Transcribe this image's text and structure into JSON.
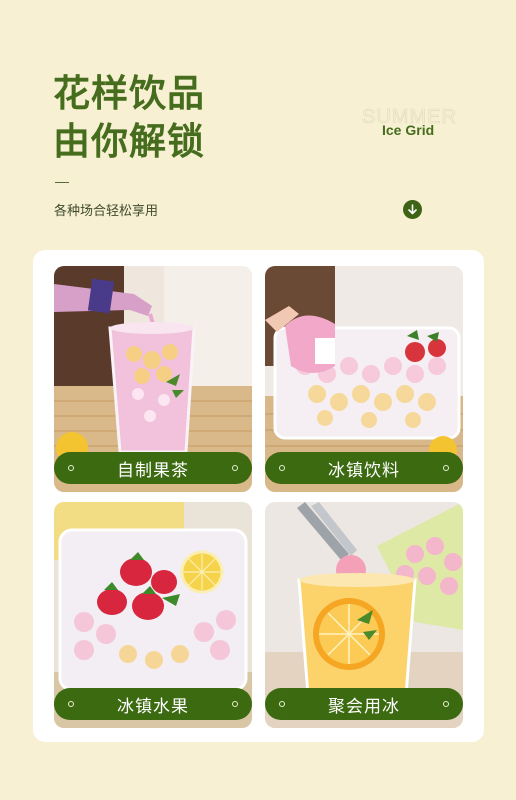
{
  "header": {
    "title_line1": "花样饮品",
    "title_line2": "由你解锁",
    "subtitle": "各种场合轻松享用",
    "summer": "SUMMER",
    "ice_grid": "Ice Grid",
    "scroll_icon": "arrow-down-icon"
  },
  "colors": {
    "brand_green": "#466d1d",
    "pill_green": "#3b6a10",
    "background": "#f7f0d2"
  },
  "cards": [
    {
      "label": "自制果茶",
      "image": "pink-drink-glass"
    },
    {
      "label": "冰镇饮料",
      "image": "ice-ball-tray-scoop"
    },
    {
      "label": "冰镇水果",
      "image": "strawberry-lemon-tray"
    },
    {
      "label": "聚会用冰",
      "image": "orange-drink-tongs"
    }
  ]
}
